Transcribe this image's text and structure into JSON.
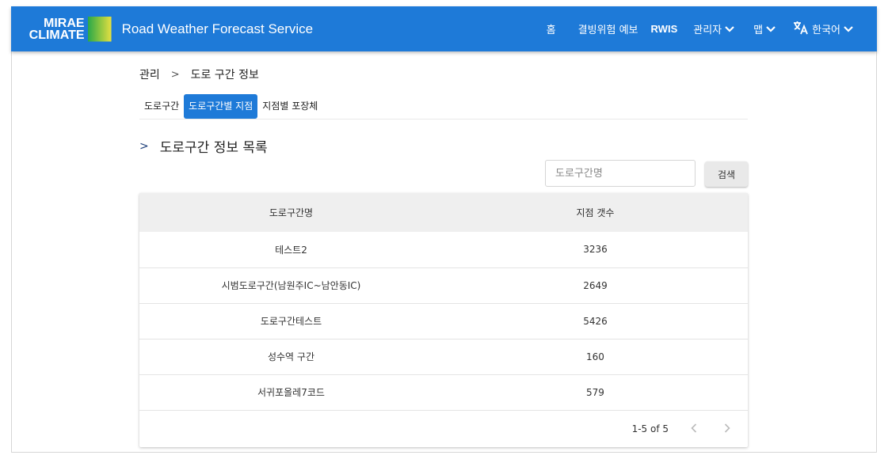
{
  "header": {
    "logo_line1": "MIRAE",
    "logo_line2": "CLIMATE",
    "app_title": "Road Weather Forecast Service",
    "nav": {
      "home": "홈",
      "forecast": "결빙위험 예보",
      "rwis": "RWIS",
      "admin": "관리자",
      "map": "맵",
      "language": "한국어"
    }
  },
  "breadcrumb": {
    "parent": "관리",
    "separator": ">",
    "current": "도로 구간 정보"
  },
  "tabs": [
    {
      "label": "도로구간"
    },
    {
      "label": "도로구간별 지점"
    },
    {
      "label": "지점별 포장체"
    }
  ],
  "section": {
    "arrow": ">",
    "title": "도로구간 정보 목록"
  },
  "search": {
    "placeholder": "도로구간명",
    "button_label": "검색"
  },
  "table": {
    "headers": [
      "도로구간명",
      "지점 갯수"
    ],
    "rows": [
      [
        "테스트2",
        "3236"
      ],
      [
        "시범도로구간(남원주IC~남안동IC)",
        "2649"
      ],
      [
        "도로구간테스트",
        "5426"
      ],
      [
        "성수역 구간",
        "160"
      ],
      [
        "서귀포올레7코드",
        "579"
      ]
    ],
    "pagination": "1-5 of 5"
  },
  "colors": {
    "appbar": "#1e7ad8",
    "active_tab": "#1e7ad8"
  },
  "icons": {
    "translate": "translate-icon",
    "chevron": "chevron-down-icon",
    "prev": "chevron-left-icon",
    "next": "chevron-right-icon"
  }
}
